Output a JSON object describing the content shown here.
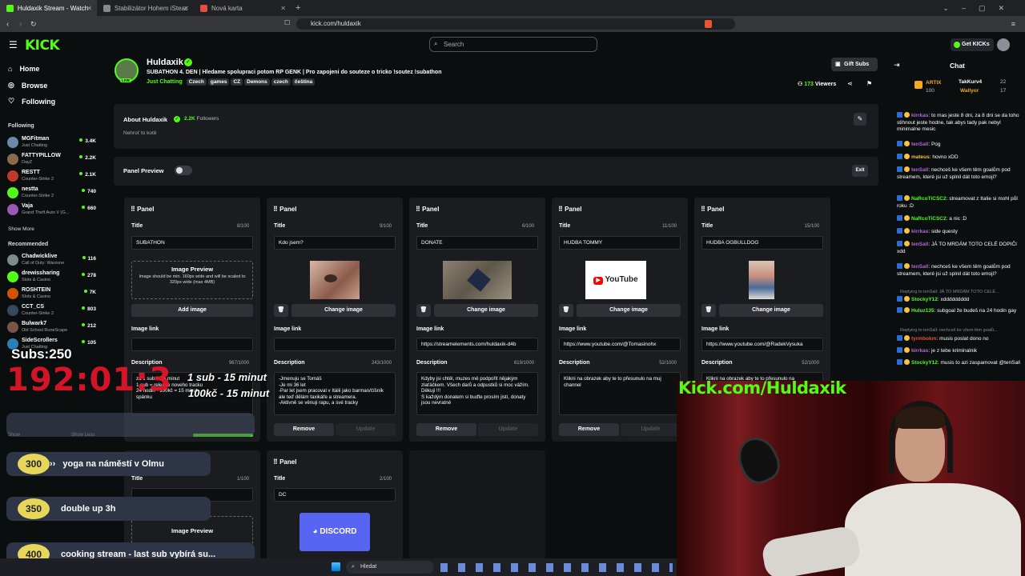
{
  "browser": {
    "tabs": [
      {
        "title": "Huldaxik Stream - Watch Live on",
        "active": true
      },
      {
        "title": "Stabilizátor Hohem iSteady Q (ST-C)",
        "active": false
      },
      {
        "title": "Nová karta",
        "active": false
      }
    ],
    "url": "kick.com/huldaxik"
  },
  "header": {
    "search_placeholder": "Search",
    "get_kicks": "Get KICKs"
  },
  "sidebar": {
    "nav": [
      {
        "label": "Home",
        "icon": "home-icon"
      },
      {
        "label": "Browse",
        "icon": "compass-icon"
      },
      {
        "label": "Following",
        "icon": "heart-icon"
      }
    ],
    "following_title": "Following",
    "following": [
      {
        "name": "MGFitman",
        "game": "Just Chatting",
        "viewers": "3.4K",
        "color": "#6a8aa8"
      },
      {
        "name": "FATTYPILLOW",
        "game": "DayZ",
        "viewers": "2.2K",
        "color": "#8a6a4a"
      },
      {
        "name": "RESTT",
        "game": "Counter-Strike 2",
        "viewers": "2.1K",
        "color": "#c0392b"
      },
      {
        "name": "nestta",
        "game": "Counter-Strike 2",
        "viewers": "740",
        "color": "#53fc18"
      },
      {
        "name": "Vaja",
        "game": "Grand Theft Auto V (G...",
        "viewers": "660",
        "color": "#9b59b6"
      }
    ],
    "show_more": "Show More",
    "recommended_title": "Recommended",
    "recommended": [
      {
        "name": "Chadwicklive",
        "game": "Call of Duty: Warzone",
        "viewers": "116",
        "color": "#7f8c8d"
      },
      {
        "name": "drewissharing",
        "game": "Slots & Casino",
        "viewers": "278",
        "color": "#53fc18"
      },
      {
        "name": "ROSHTEIN",
        "game": "Slots & Casino",
        "viewers": "7K",
        "color": "#d35400"
      },
      {
        "name": "CCT_CS",
        "game": "Counter-Strike 2",
        "viewers": "803",
        "color": "#34495e"
      },
      {
        "name": "Bulwark7",
        "game": "Old School RuneScape",
        "viewers": "212",
        "color": "#795548"
      },
      {
        "name": "SideScrollers",
        "game": "Just Chatting",
        "viewers": "105",
        "color": "#2980b9"
      }
    ],
    "show_less": "Show Less",
    "show_more_bottom": "Show"
  },
  "channel": {
    "name": "Huldaxik",
    "live_badge": "LIVE",
    "title": "SUBATHON 4. DEN | Hledame spolupraci potom RP GENK | Pro zapojeni do souteze o tricko !soutez !subathon",
    "category": "Just Chatting",
    "tags": [
      "Czech",
      "games",
      "CZ",
      "Demons",
      "czech",
      "čeština"
    ],
    "gift_subs": "Gift Subs",
    "viewers": "173",
    "viewers_label": "Viewers"
  },
  "about": {
    "title": "About Huldaxik",
    "followers": "2.2K",
    "followers_label": "Followers",
    "bio": "Nehroť to kotě"
  },
  "panel_preview": {
    "label": "Panel Preview",
    "exit": "Exit"
  },
  "panel_labels": {
    "heading": "Panel",
    "title": "Title",
    "image_link": "Image link",
    "description": "Description",
    "remove": "Remove",
    "update": "Update",
    "add_image": "Add image",
    "change_image": "Change image"
  },
  "image_preview": {
    "title": "Image Preview",
    "hint": "Image should be min. 160px wide and will be scaled to 320px wide (max 4MB)"
  },
  "panels": [
    {
      "title": "SUBATHON",
      "title_count": "8/100",
      "link": "",
      "desc_count": "967/1000",
      "desc": "za 1 sub + 15 minut\n1 sub = release noveho tracku\n24 hodin - 100kč = 15 minut\nspánku",
      "image": "none"
    },
    {
      "title": "Kdo jsem?",
      "title_count": "9/100",
      "link": "",
      "desc_count": "243/1000",
      "desc": "-Jmenuju se Tomáš\n-Je mi 36 let\n-Par let jsem pracoval v Itálii jako barman/číšník ale teď dělám taxikáře a streamera.\n-Aktivně se věnuji rapu, a své tracky",
      "image": "face"
    },
    {
      "title": "DONATE",
      "title_count": "6/100",
      "link": "https://streamelements.com/huldaxik-d4b",
      "desc_count": "619/1000",
      "desc": "Kdyby jsi chtěl, muzes mě podpořit nějakým zlaťáčkem. Všech darů a odpustků si moc vážím. Děkuji !!!\nS každým donatem si buďte prosím jistí, donaty jsou nevratné",
      "image": "photo"
    },
    {
      "title": "HUDBA TOMMY",
      "title_count": "11/100",
      "link": "https://www.youtube.com/@Tomasinohx",
      "desc_count": "52/1000",
      "desc": "Klikni na obrazek aby te to přesunulo na muj channel",
      "image": "youtube"
    },
    {
      "title": "HUDBA OGBULLDOG",
      "title_count": "15/100",
      "link": "https://www.youtube.com/@RadekVysuka",
      "desc_count": "52/1000",
      "desc": "Klikni na obrazek aby te to přesunulo na",
      "image": "person"
    }
  ],
  "panels_row2": [
    {
      "title": "",
      "title_count": "1/100"
    },
    {
      "title": "DC",
      "title_count": "2/100",
      "image_text": "DISCORD"
    }
  ],
  "youtube_text": "YouTube",
  "chat": {
    "title": "Chat",
    "pinned": [
      {
        "name": "ARTIX",
        "amount": "100"
      },
      {
        "name": "TakKurv4",
        "amount": "22"
      },
      {
        "name": "Wallyor",
        "amount": "17"
      }
    ],
    "messages": [
      {
        "user": "kirrkas",
        "color": "#b06bd6",
        "text": "to mas jeste 8 dni, za 8 dni se da toho stihnout jeste hodne, tak abys tady pak nebyl minimalne mesic"
      },
      {
        "user": "tenSall",
        "color": "#b06bd6",
        "text": "Pog"
      },
      {
        "user": "mateus",
        "color": "#f5c242",
        "text": "hovno xDD"
      },
      {
        "user": "tenSall",
        "color": "#b06bd6",
        "text": "nechceš ke všem těm goalům pod streamem, které jsi už splnil dát toto emoji?"
      },
      {
        "user": "NaRcoTiCSC2",
        "color": "#53fc18",
        "text": "streamovat z Italie si mohl půl roku :D"
      },
      {
        "user": "NaRcoTiCSC2",
        "color": "#53fc18",
        "text": "a nic :D"
      },
      {
        "user": "kirrkas",
        "color": "#b06bd6",
        "text": "side questy"
      },
      {
        "user": "tenSall",
        "color": "#b06bd6",
        "text": "JÁ TO MRDÁM TOTO CELÉ DOPIČI xdd"
      },
      {
        "user": "tenSall",
        "color": "#b06bd6",
        "text": "nechceš ke všem těm goalům pod streamem, které jsi už splnil dát toto emoji?"
      },
      {
        "user": "StockyY12",
        "color": "#53fc18",
        "text": "xddddddddd"
      },
      {
        "user": "Huluz135",
        "color": "#53fc18",
        "text": "subgoal že budeš na 24 hodin gay"
      },
      {
        "user": "tyrmbokm",
        "color": "#e74c3c",
        "text": "musis poslat dono no"
      },
      {
        "user": "kirrkas",
        "color": "#b06bd6",
        "text": "je z tebe kriminalnik"
      },
      {
        "user": "StockyY12",
        "color": "#53fc18",
        "text": "musis to azi zaspamovat @tenSall"
      }
    ],
    "reply_1": "Replying to tenSall: JÁ TO MRDÁM TOTO CELÉ...",
    "reply_2": "Replying to tenSall: nechceš ke všem těm goalů..."
  },
  "overlay": {
    "subs_label": "Subs:",
    "subs_value": "250",
    "timer": "192:01:3",
    "rule_1": "1 sub - 15 minut",
    "rule_2": "100kč - 15 minut",
    "kick_url": "Kick.com/Huldaxik",
    "goals": [
      {
        "amount": "300",
        "text": "yoga na náměstí v Olmu"
      },
      {
        "amount": "350",
        "text": "double up 3h"
      },
      {
        "amount": "400",
        "text": "cooking stream - last sub vybírá su..."
      }
    ]
  },
  "taskbar": {
    "search": "Hledat"
  }
}
